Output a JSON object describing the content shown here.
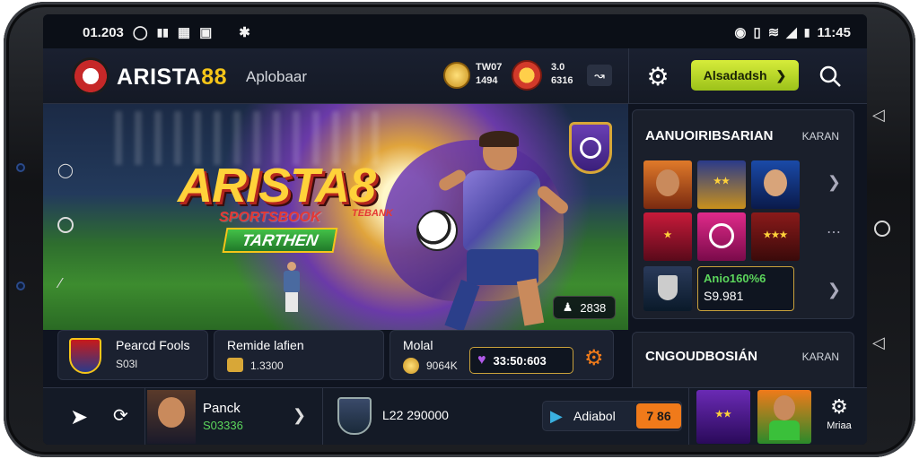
{
  "status_bar": {
    "time_left": "01.203",
    "time_right": "11:45"
  },
  "header": {
    "brand_main": "ARISTA",
    "brand_accent": "88",
    "subtitle": "Aplobaar",
    "coin1_line1": "TW07",
    "coin1_line2": "1494",
    "coin2_line1": "3.0",
    "coin2_line2": "6316",
    "cta_label": "Alsadadsh"
  },
  "hero": {
    "title": "ARISTA8",
    "subtitle": "SPORTSBOOK",
    "subtitle_small": "TEBANK",
    "tag": "TARTHEN",
    "counter": "2838"
  },
  "side_panel": {
    "heading": "AANUOIRIBSARIAN",
    "link": "KARAN",
    "promo_line1": "Anio160%6",
    "promo_line2": "S9.981"
  },
  "side_panel2": {
    "heading": "CNGOUDBOSIÁN",
    "link": "KARAN"
  },
  "cards": [
    {
      "title": "Pearcd Fools",
      "value": "S03l"
    },
    {
      "title": "Remide lafien",
      "value": "1.3300"
    },
    {
      "title": "Molal",
      "value": "9064K"
    }
  ],
  "card3_amount": "33:50:603",
  "bottom": {
    "player_name": "Panck",
    "player_value": "S03336",
    "mid_text": "L22 290000",
    "action_label": "Adiabol",
    "badge": "7 86",
    "menu_label": "Mriaa"
  },
  "colors": {
    "accent_yellow": "#f5c518",
    "cta_green": "#b8d82a",
    "panel_bg": "#1a1f2b"
  }
}
